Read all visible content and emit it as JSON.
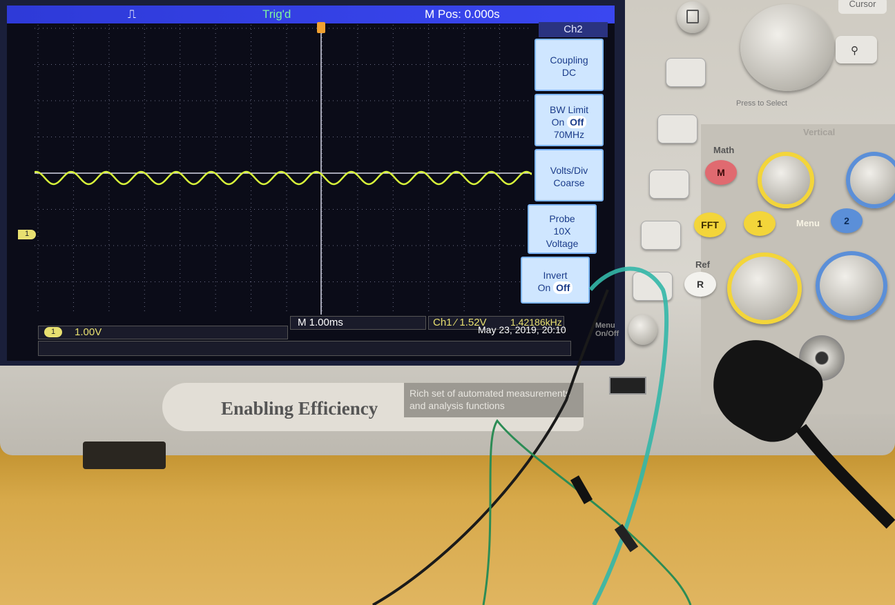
{
  "scope": {
    "trigger_status": "Trig'd",
    "m_pos": "M Pos: 0.000s",
    "menu": {
      "title": "Ch2",
      "items": [
        {
          "line1": "Coupling",
          "line2": "DC",
          "line3": ""
        },
        {
          "line1": "BW Limit",
          "on": "On",
          "off": "Off",
          "line3": "70MHz"
        },
        {
          "line1": "Volts/Div",
          "line2": "Coarse",
          "line3": ""
        },
        {
          "line1": "Probe",
          "line2": "10X",
          "line3": "Voltage"
        },
        {
          "line1": "Invert",
          "on": "On",
          "off": "Off",
          "line3": ""
        }
      ]
    },
    "ch1_marker": "1",
    "ch1_scale": "1.00V",
    "timebase": "M 1.00ms",
    "trigger_info": "Ch1 ⁄ 1.52V",
    "frequency": "1.42186kHz",
    "datetime": "May 23, 2019, 20:10",
    "trace_color": "#d8f53a"
  },
  "banner": {
    "brand": "Enabling Efficiency",
    "tagline": "Rich set of automated measurements and analysis functions"
  },
  "panel": {
    "cursor_label": "Cursor",
    "press_to_select": "Press to Select",
    "vertical_label": "Vertical",
    "math_label": "Math",
    "math_button": "M",
    "fft_button": "FFT",
    "ch1_button": "1",
    "ch2_button": "2",
    "menu_label": "Menu",
    "ref_label": "Ref",
    "ref_button": "R",
    "menu_onoff": "Menu On/Off"
  }
}
